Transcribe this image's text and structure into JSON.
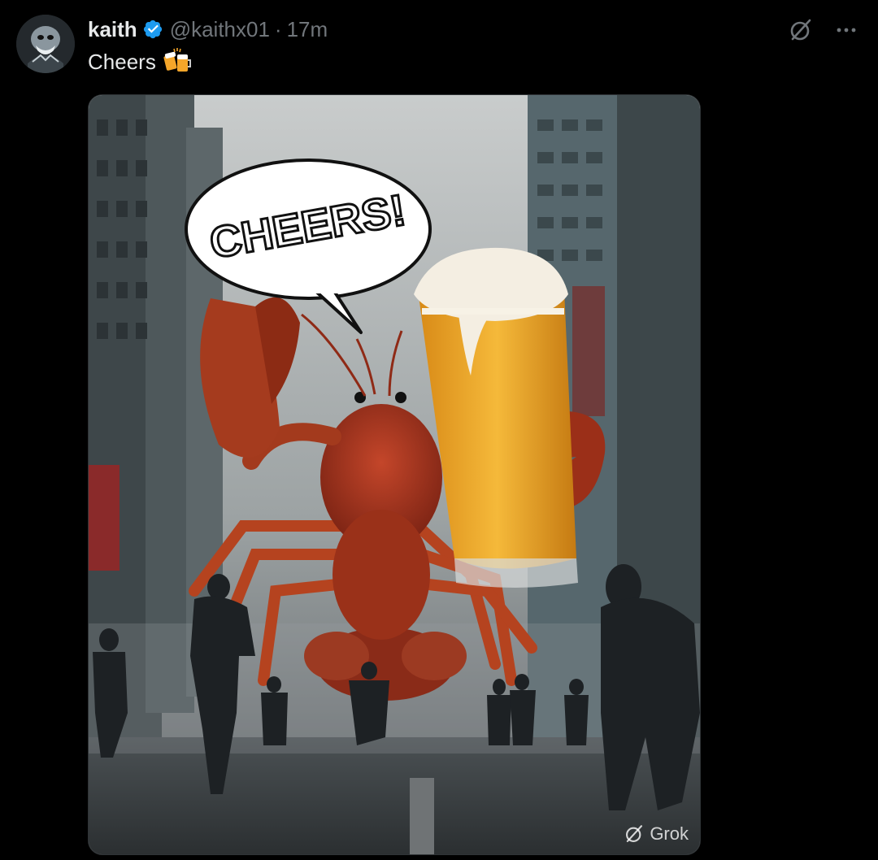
{
  "post": {
    "author_name": "kaith",
    "handle": "@kaithx01",
    "separator": "·",
    "time": "17m",
    "text": "Cheers",
    "emoji_icon": "clinking-beer-mugs-icon"
  },
  "media": {
    "speech_bubble_text": "CHEERS!",
    "watermark_text": "Grok",
    "watermark_icon": "grok-icon"
  },
  "actions": {
    "grok_icon": "grok-icon",
    "more_icon": "more-dots-icon"
  },
  "colors": {
    "background": "#000000",
    "text_primary": "#e7e9ea",
    "text_secondary": "#71767b",
    "verified_blue": "#1d9bf0"
  }
}
